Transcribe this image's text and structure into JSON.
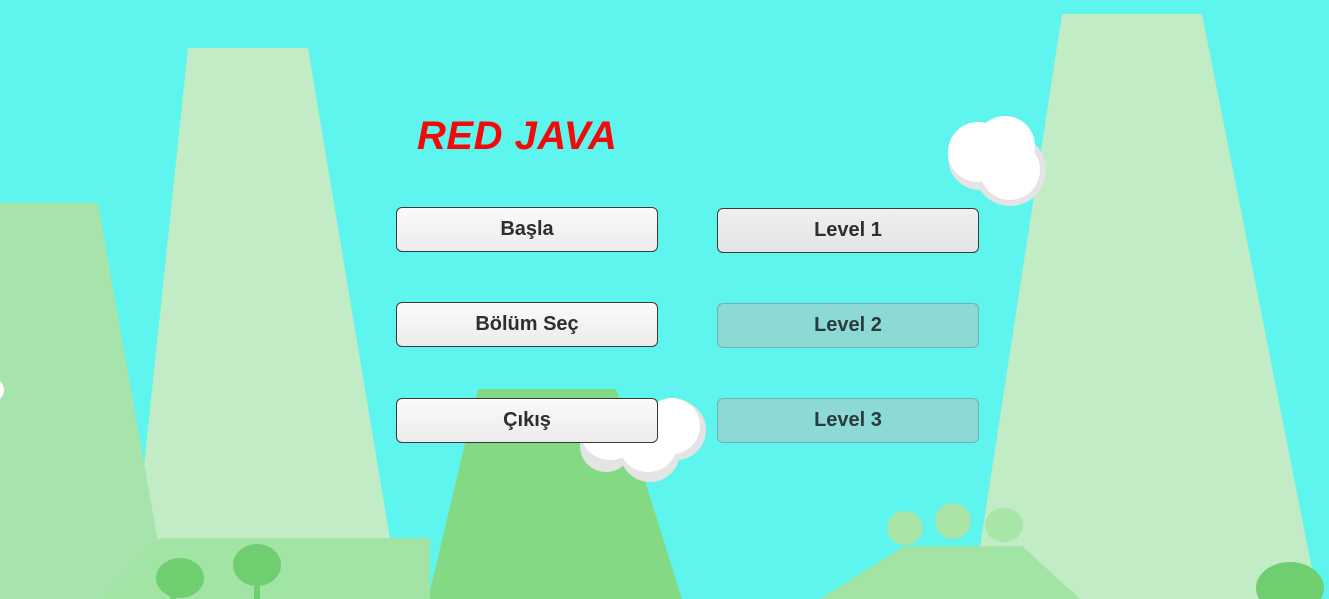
{
  "title": "RED JAVA",
  "menu": {
    "start_label": "Başla",
    "select_level_label": "Bölüm Seç",
    "exit_label": "Çıkış"
  },
  "levels": {
    "level1_label": "Level 1",
    "level2_label": "Level 2",
    "level3_label": "Level 3"
  },
  "colors": {
    "sky": "#5ef5ee",
    "title": "#f20a0a",
    "mountain_light": "#c1ecc5",
    "hill_green": "#84d984",
    "ground_green": "#a2e4a3",
    "locked_button": "#8cd9d6"
  }
}
